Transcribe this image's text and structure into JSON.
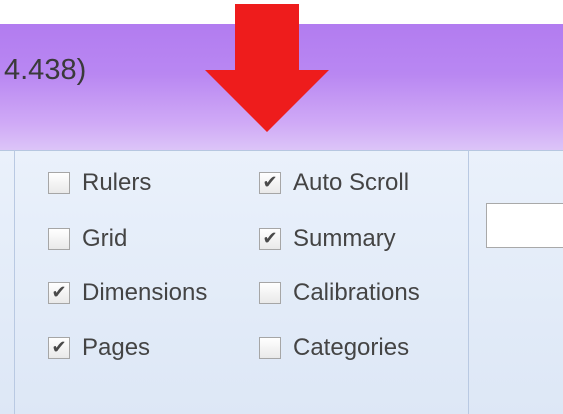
{
  "window": {
    "title_fragment": "4.438)"
  },
  "annotation": {
    "arrow_icon": "red-down-arrow-icon",
    "arrow_color": "#ee1c1c"
  },
  "view_options": {
    "checkboxes": [
      {
        "label": "Rulers",
        "checked": false
      },
      {
        "label": "Auto Scroll",
        "checked": true
      },
      {
        "label": "Grid",
        "checked": false
      },
      {
        "label": "Summary",
        "checked": true
      },
      {
        "label": "Dimensions",
        "checked": true
      },
      {
        "label": "Calibrations",
        "checked": false
      },
      {
        "label": "Pages",
        "checked": true
      },
      {
        "label": "Categories",
        "checked": false
      }
    ]
  },
  "input": {
    "value": ""
  },
  "colors": {
    "titlebar": "#b987f2",
    "ribbon": "#e2ebf8",
    "check_mark": "#4a4a4a"
  }
}
